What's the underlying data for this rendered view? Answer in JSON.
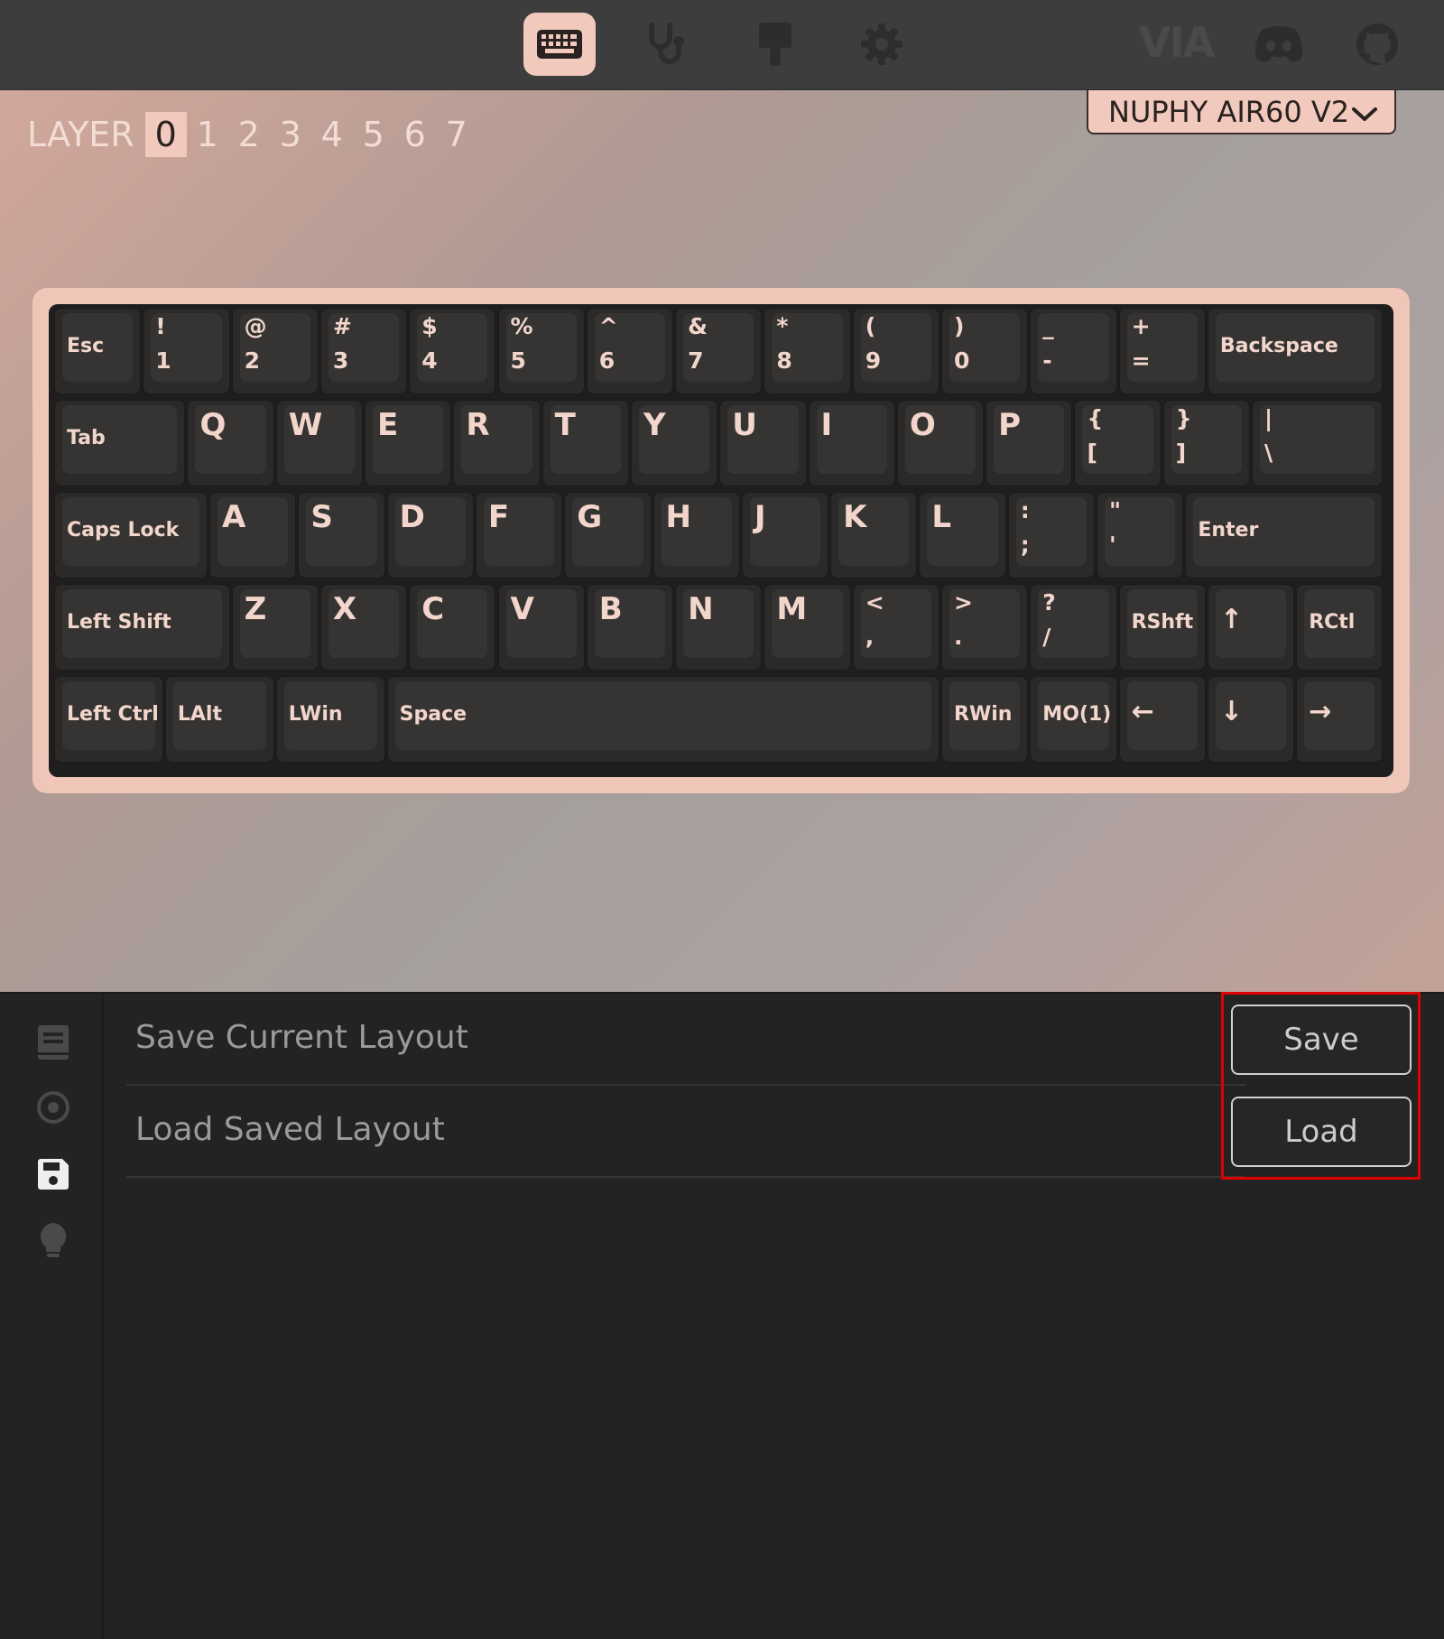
{
  "nav": {
    "items": [
      {
        "name": "configure",
        "icon": "keyboard-icon",
        "active": true
      },
      {
        "name": "test",
        "icon": "stethoscope-icon",
        "active": false
      },
      {
        "name": "design",
        "icon": "brush-icon",
        "active": false
      },
      {
        "name": "settings",
        "icon": "gear-icon",
        "active": false
      }
    ],
    "brand": "VIA",
    "external": [
      "discord-icon",
      "github-icon"
    ]
  },
  "layer": {
    "label": "LAYER",
    "numbers": [
      "0",
      "1",
      "2",
      "3",
      "4",
      "5",
      "6",
      "7"
    ],
    "active": "0"
  },
  "device": {
    "selected": "NUPHY AIR60 V2"
  },
  "keyboard": {
    "rows": [
      [
        "Esc",
        "!\n1",
        "@\n2",
        "#\n3",
        "$\n4",
        "%\n5",
        "^\n6",
        "&\n7",
        "*\n8",
        "(\n9",
        ")\n0",
        "_\n-",
        "+\n=",
        "Backspace"
      ],
      [
        "Tab",
        "Q",
        "W",
        "E",
        "R",
        "T",
        "Y",
        "U",
        "I",
        "O",
        "P",
        "{\n[",
        "}\n]",
        "|\n\\"
      ],
      [
        "Caps Lock",
        "A",
        "S",
        "D",
        "F",
        "G",
        "H",
        "J",
        "K",
        "L",
        ":\n;",
        "\"\n'",
        "Enter"
      ],
      [
        "Left Shift",
        "Z",
        "X",
        "C",
        "V",
        "B",
        "N",
        "M",
        "<\n,",
        ">\n.",
        "?\n/",
        "RShft",
        "↑",
        "RCtl"
      ],
      [
        "Left Ctrl",
        "LAlt",
        "LWin",
        "Space",
        "RWin",
        "MO(1)",
        "←",
        "↓",
        "→"
      ]
    ]
  },
  "sidebar": {
    "icons": [
      "book-icon",
      "macro-icon",
      "save-icon",
      "lightbulb-icon"
    ],
    "active": "save-icon"
  },
  "save_load": {
    "save_label": "Save Current Layout",
    "save_button": "Save",
    "load_label": "Load Saved Layout",
    "load_button": "Load"
  },
  "colors": {
    "accent": "#f2c9bd",
    "highlight": "#e00000",
    "key_text": "#f2d6cb"
  }
}
